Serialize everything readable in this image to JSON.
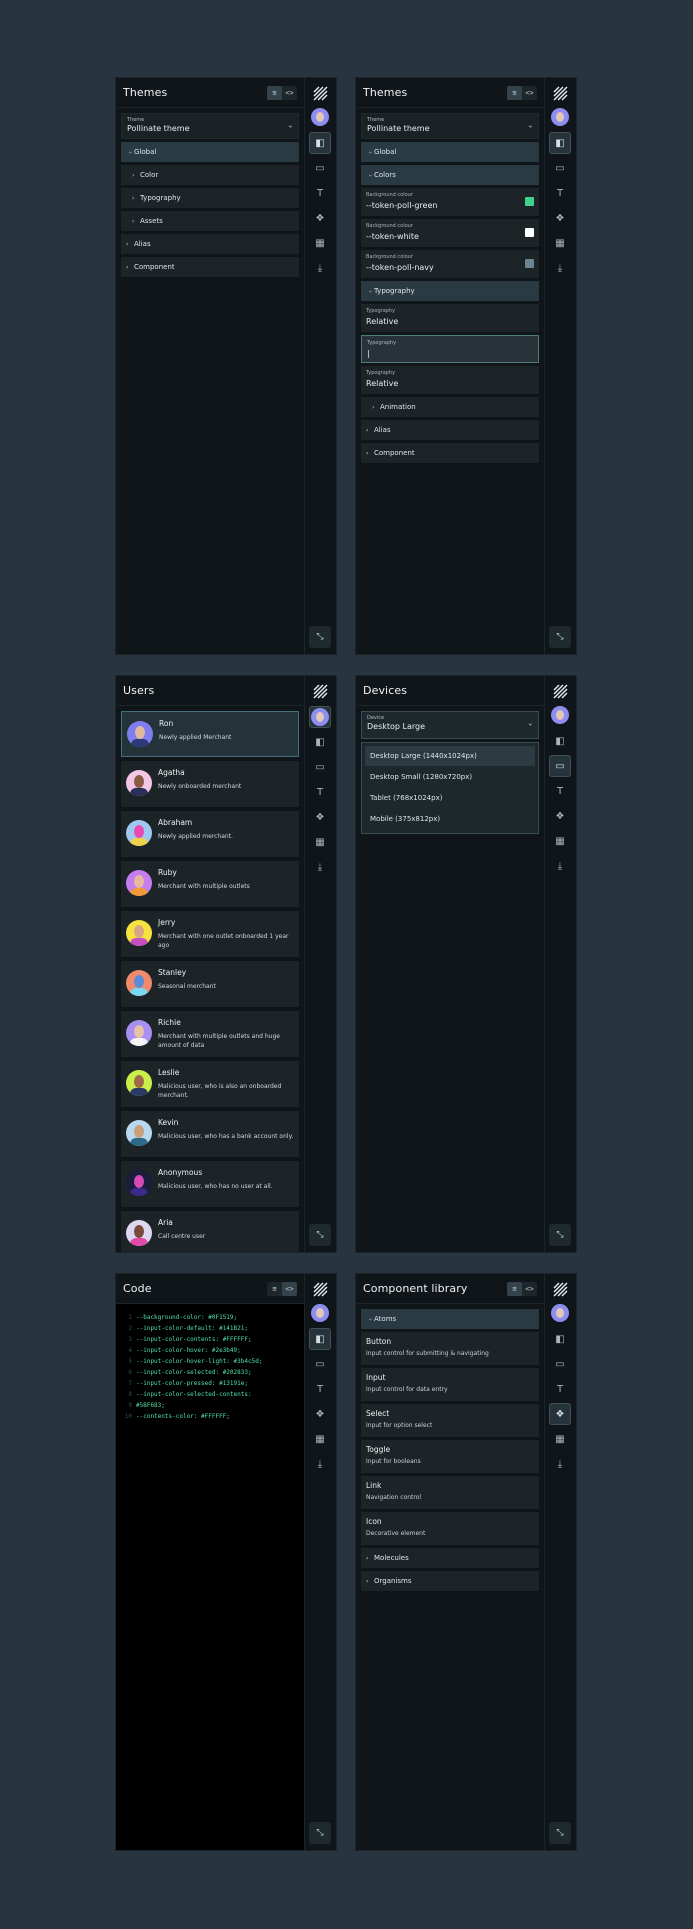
{
  "header_buttons": {
    "list": "≡",
    "code": "<>"
  },
  "themes_panel": {
    "title": "Themes",
    "theme_select": {
      "label": "Theme",
      "value": "Pollinate theme"
    },
    "items": [
      {
        "label": "Global",
        "open": true
      },
      {
        "label": "Color",
        "sub": true
      },
      {
        "label": "Typography",
        "sub": true
      },
      {
        "label": "Assets",
        "sub": true
      },
      {
        "label": "Alias"
      },
      {
        "label": "Component"
      }
    ]
  },
  "themes_panel_expanded": {
    "title": "Themes",
    "theme_select": {
      "label": "Theme",
      "value": "Pollinate theme"
    },
    "global_label": "Global",
    "colors_label": "Colors",
    "color_fields": [
      {
        "label": "Background colour",
        "value": "--token-poll-green",
        "color": "#3fd28b"
      },
      {
        "label": "Background colour",
        "value": "--token-white",
        "color": "#ffffff"
      },
      {
        "label": "Background colour",
        "value": "--token-poll-navy",
        "color": "#6b8691"
      }
    ],
    "typography_label": "Typography",
    "typography_fields": [
      {
        "label": "Typography",
        "value": "Relative"
      },
      {
        "label": "Typography",
        "value": "|"
      },
      {
        "label": "Typography",
        "value": "Relative"
      }
    ],
    "animation_label": "Animation",
    "alias_label": "Alias",
    "component_label": "Component"
  },
  "users_panel": {
    "title": "Users",
    "users": [
      {
        "name": "Ron",
        "desc": "Newly applied Merchant",
        "bg": "#7e7ef0",
        "face": "#e0b99c",
        "body": "#2c3a76"
      },
      {
        "name": "Agatha",
        "desc": "Newly onboarded merchant",
        "bg": "#f2c6e4",
        "face": "#8a5a43",
        "body": "#2a2f5a"
      },
      {
        "name": "Abraham",
        "desc": "Newly applied merchant.",
        "bg": "#9ec8f0",
        "face": "#e94ab0",
        "body": "#f0d24a"
      },
      {
        "name": "Ruby",
        "desc": "Merchant with multiple outlets",
        "bg": "#c57df0",
        "face": "#e8b8a0",
        "body": "#f09a3a"
      },
      {
        "name": "Jerry",
        "desc": "Merchant with one outlet onboarded 1 year ago",
        "bg": "#f5e23e",
        "face": "#d9a585",
        "body": "#c44ec2"
      },
      {
        "name": "Stanley",
        "desc": "Seasonal merchant",
        "bg": "#f08a6a",
        "face": "#5a8bd8",
        "body": "#7ad9f0"
      },
      {
        "name": "Richie",
        "desc": "Merchant with multiple outlets and huge amount of data",
        "bg": "#a890f0",
        "face": "#e6c2a8",
        "body": "#f4f4f4"
      },
      {
        "name": "Leslie",
        "desc": "Malicious user, who is also an onboarded merchant.",
        "bg": "#c9f04a",
        "face": "#a06a4a",
        "body": "#2a3a66"
      },
      {
        "name": "Kevin",
        "desc": "Malicious user, who has a bank account only.",
        "bg": "#b8d8f0",
        "face": "#caa07a",
        "body": "#2e6b8a"
      },
      {
        "name": "Anonymous",
        "desc": "Malicious user, who has no user at all.",
        "bg": "#1a1d3a",
        "face": "#d64ab8",
        "body": "#3a2a8a"
      },
      {
        "name": "Aria",
        "desc": "Call centre user",
        "bg": "#dcd8f0",
        "face": "#7a4a3a",
        "body": "#e24aa8"
      }
    ]
  },
  "devices_panel": {
    "title": "Devices",
    "device_select": {
      "label": "Device",
      "value": "Desktop Large"
    },
    "options": [
      "Desktop Large (1440x1024px)",
      "Desktop Small (1280x720px)",
      "Tablet (768x1024px)",
      "Mobile (375x812px)"
    ]
  },
  "code_panel": {
    "title": "Code",
    "lines": [
      "--background-color: #0F1519;",
      "--input-color-default: #141B21;",
      "--input-color-contents: #FFFFFF;",
      "--input-color-hover: #2e3b49;",
      "--input-color-hover-light: #3b4c5d;",
      "--input-color-selected: #202833;",
      "--input-color-pressed: #13191e;",
      "--input-color-selected-contents:",
      "#5BF683;",
      "--contents-color: #FFFFFF;"
    ]
  },
  "library_panel": {
    "title": "Component library",
    "atoms_label": "Atoms",
    "items": [
      {
        "name": "Button",
        "desc": "Input control for submitting & navigating"
      },
      {
        "name": "Input",
        "desc": "Input control for data entry"
      },
      {
        "name": "Select",
        "desc": "Input for option select"
      },
      {
        "name": "Toggle",
        "desc": "Input for booleans"
      },
      {
        "name": "Link",
        "desc": "Navigation control"
      },
      {
        "name": "Icon",
        "desc": "Decorative element"
      }
    ],
    "molecules_label": "Molecules",
    "organisms_label": "Organisms"
  }
}
